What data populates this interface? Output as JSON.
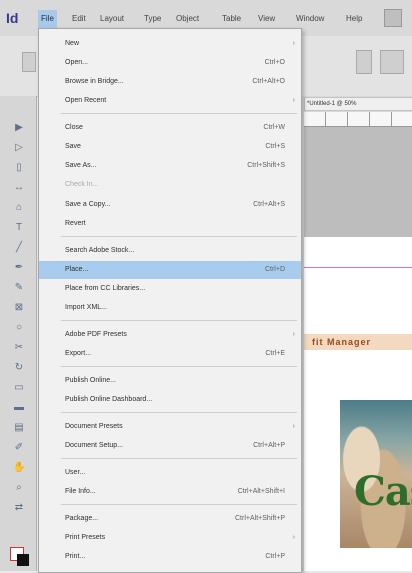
{
  "app": {
    "logo": "Id",
    "menubar": [
      "File",
      "Edit",
      "Layout",
      "Type",
      "Object",
      "Table",
      "View",
      "Window",
      "Help"
    ]
  },
  "document": {
    "tab_title": "*Untitled-1 @ 50%",
    "page_text": "fit Manager",
    "photo_text": "Cas"
  },
  "file_menu": {
    "items": [
      {
        "label": "New",
        "shortcut": "",
        "submenu": true
      },
      {
        "label": "Open...",
        "shortcut": "Ctrl+O"
      },
      {
        "label": "Browse in Bridge...",
        "shortcut": "Ctrl+Alt+O"
      },
      {
        "label": "Open Recent",
        "shortcut": "",
        "submenu": true
      },
      {
        "label": "Close",
        "shortcut": "Ctrl+W"
      },
      {
        "label": "Save",
        "shortcut": "Ctrl+S"
      },
      {
        "label": "Save As...",
        "shortcut": "Ctrl+Shift+S"
      },
      {
        "label": "Check In...",
        "shortcut": "",
        "disabled": true
      },
      {
        "label": "Save a Copy...",
        "shortcut": "Ctrl+Alt+S"
      },
      {
        "label": "Revert",
        "shortcut": ""
      },
      {
        "label": "Search Adobe Stock...",
        "shortcut": ""
      },
      {
        "label": "Place...",
        "shortcut": "Ctrl+D",
        "highlight": true
      },
      {
        "label": "Place from CC Libraries...",
        "shortcut": ""
      },
      {
        "label": "Import XML...",
        "shortcut": ""
      },
      {
        "label": "Adobe PDF Presets",
        "shortcut": "",
        "submenu": true
      },
      {
        "label": "Export...",
        "shortcut": "Ctrl+E"
      },
      {
        "label": "Publish Online...",
        "shortcut": ""
      },
      {
        "label": "Publish Online Dashboard...",
        "shortcut": ""
      },
      {
        "label": "Document Presets",
        "shortcut": "",
        "submenu": true
      },
      {
        "label": "Document Setup...",
        "shortcut": "Ctrl+Alt+P"
      },
      {
        "label": "User...",
        "shortcut": ""
      },
      {
        "label": "File Info...",
        "shortcut": "Ctrl+Alt+Shift+I"
      },
      {
        "label": "Package...",
        "shortcut": "Ctrl+Alt+Shift+P"
      },
      {
        "label": "Print Presets",
        "shortcut": "",
        "submenu": true
      },
      {
        "label": "Print...",
        "shortcut": "Ctrl+P"
      }
    ]
  },
  "colors": {
    "highlight": "#a8ccee",
    "guide": "#e86fb3"
  }
}
